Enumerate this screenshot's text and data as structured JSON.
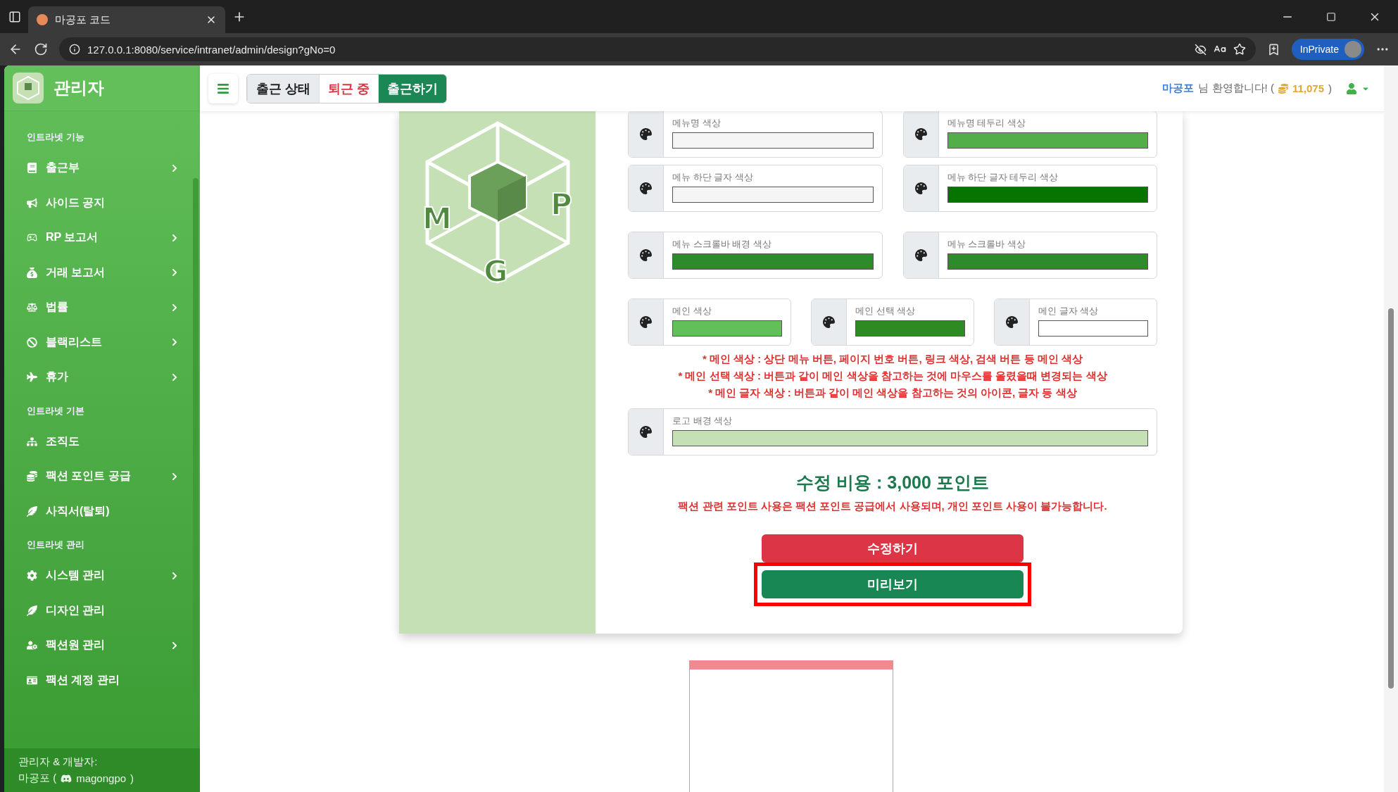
{
  "browser": {
    "tab_title": "마공포 코드",
    "url": "127.0.0.1:8080/service/intranet/admin/design?gNo=0",
    "profile_label": "InPrivate"
  },
  "sidebar": {
    "title": "관리자",
    "sections": [
      {
        "title": "인트라넷 기능",
        "items": [
          {
            "label": "출근부",
            "has_submenu": true
          },
          {
            "label": "사이드 공지",
            "has_submenu": false
          },
          {
            "label": "RP 보고서",
            "has_submenu": true
          },
          {
            "label": "거래 보고서",
            "has_submenu": true
          },
          {
            "label": "법률",
            "has_submenu": true
          },
          {
            "label": "블랙리스트",
            "has_submenu": true
          },
          {
            "label": "휴가",
            "has_submenu": true
          }
        ]
      },
      {
        "title": "인트라넷 기본",
        "items": [
          {
            "label": "조직도",
            "has_submenu": false
          },
          {
            "label": "팩션 포인트 공급",
            "has_submenu": true
          },
          {
            "label": "사직서(탈퇴)",
            "has_submenu": false
          }
        ]
      },
      {
        "title": "인트라넷 관리",
        "items": [
          {
            "label": "시스템 관리",
            "has_submenu": true
          },
          {
            "label": "디자인 관리",
            "has_submenu": false
          },
          {
            "label": "팩션원 관리",
            "has_submenu": true
          },
          {
            "label": "팩션 계정 관리",
            "has_submenu": false
          }
        ]
      }
    ],
    "footer": {
      "caption": "관리자 & 개발자:",
      "name": "마공포 (",
      "handle": "magongpo",
      "close": ")"
    }
  },
  "topbar": {
    "status": [
      {
        "label": "출근 상태",
        "kind": "caption"
      },
      {
        "label": "퇴근 중",
        "kind": "state"
      },
      {
        "label": "출근하기",
        "kind": "action"
      }
    ],
    "welcome": {
      "name": "마공포",
      "greeting": "님 환영합니다! (",
      "points": "11,075",
      "close": ")"
    }
  },
  "logo": {
    "letters": [
      "M",
      "G",
      "P"
    ]
  },
  "field_rows": [
    {
      "fields": [
        {
          "label": "메뉴명 색상",
          "color": "#f5f5f5"
        },
        {
          "label": "메뉴명 테두리 색상",
          "color": "#52ae48"
        }
      ]
    },
    {
      "fields": [
        {
          "label": "메뉴 하단 글자 색상",
          "color": "#f5f5f5"
        },
        {
          "label": "메뉴 하단 글자 테두리 색상",
          "color": "#087400"
        }
      ]
    },
    {
      "fields": [
        {
          "label": "메뉴 스크롤바 배경 색상",
          "color": "#2e8b2b"
        },
        {
          "label": "메뉴 스크롤바 색상",
          "color": "#2e8b2b"
        }
      ]
    },
    {
      "fields": [
        {
          "label": "메인 색상",
          "color": "#62c05a"
        },
        {
          "label": "메인 선택 색상",
          "color": "#2e8b24"
        },
        {
          "label": "메인 글자 색상",
          "color": "#ffffff"
        }
      ]
    }
  ],
  "notes": [
    "* 메인 색상 : 상단 메뉴 버튼, 페이지 번호 버튼, 링크 색상, 검색 버튼 등 메인 색상",
    "* 메인 선택 색상 : 버튼과 같이 메인 색상을 참고하는 것에 마우스를 올렸을때 변경되는 색상",
    "* 메인 글자 색상 : 버튼과 같이 메인 색상을 참고하는 것의 아이콘, 글자 등 색상"
  ],
  "logo_field": {
    "label": "로고 배경 색상",
    "color": "#c5e0b4"
  },
  "cost": {
    "title": "수정 비용 : 3,000 포인트",
    "note": "팩션 관련 포인트 사용은 팩션 포인트 공급에서 사용되며, 개인 포인트 사용이 불가능합니다."
  },
  "actions": [
    {
      "label": "수정하기",
      "kind": "danger"
    },
    {
      "label": "미리보기",
      "kind": "primary",
      "highlighted": true
    }
  ]
}
